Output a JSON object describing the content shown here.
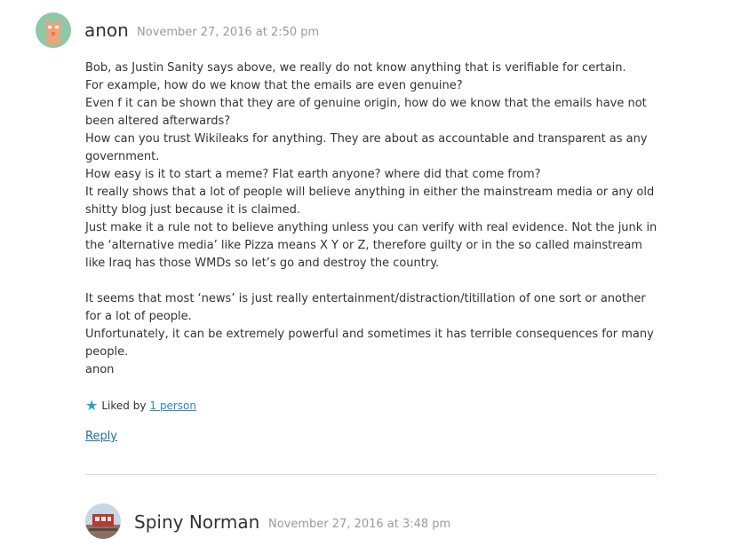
{
  "comments": [
    {
      "author": "anon",
      "date": "November 27, 2016 at 2:50 pm",
      "lines": [
        "Bob, as Justin Sanity says above, we really do not know anything that is verifiable for certain.",
        "For example, how do we know that the emails are even genuine?",
        "Even f it can be shown that they are of genuine origin, how do we know that the emails have not been altered afterwards?",
        "How can you trust Wikileaks for anything. They are about as accountable and transparent as any government.",
        "How easy is it to start a meme? Flat earth anyone? where did that come from?",
        "It really shows that a lot of people will believe anything in either the mainstream media or any old shitty blog just because it is claimed.",
        "Just make it a rule not to believe anything unless you can verify with real evidence. Not the junk in the ‘alternative media’ like Pizza means X Y or Z, therefore guilty or in the so called mainstream like Iraq has those WMDs so let’s go and destroy the country.",
        "",
        "It seems that most ‘news’ is just really entertainment/distraction/titillation of one sort or another for a lot of people.",
        "Unfortunately, it can be extremely powerful and sometimes it has terrible consequences for many people.",
        "anon"
      ],
      "liked_by_label": "Liked by",
      "liked_by_link": "1 person",
      "reply_label": "Reply"
    },
    {
      "author": "Spiny Norman",
      "date": "November 27, 2016 at 3:48 pm"
    }
  ],
  "colors": {
    "link": "#1f6fa5",
    "star": "#2e9fd1",
    "date": "#9a9a9a",
    "divider": "#dddddd"
  },
  "icons": {
    "avatar_anon": "pixel-face-avatar",
    "avatar_spiny": "photo-avatar",
    "like": "star-icon"
  }
}
